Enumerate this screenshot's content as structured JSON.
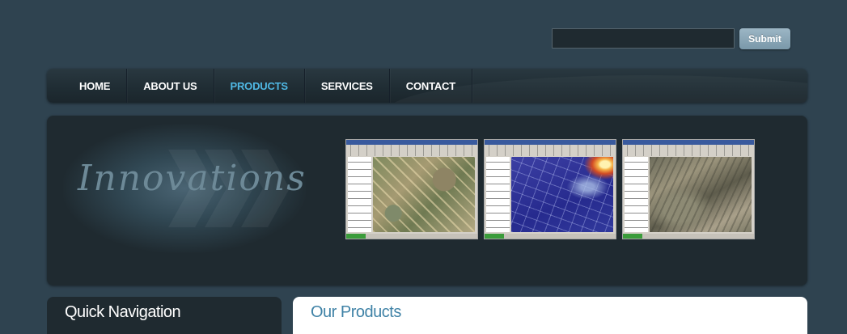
{
  "search": {
    "value": "",
    "placeholder": "",
    "submit_label": "Submit"
  },
  "nav": {
    "items": [
      {
        "label": "HOME",
        "active": false
      },
      {
        "label": "ABOUT US",
        "active": false
      },
      {
        "label": "PRODUCTS",
        "active": true
      },
      {
        "label": "SERVICES",
        "active": false
      },
      {
        "label": "CONTACT",
        "active": false
      }
    ]
  },
  "hero": {
    "title": "Innovations",
    "screenshots": [
      {
        "icon": "gis-aerial-map-thumbnail"
      },
      {
        "icon": "gis-plume-map-thumbnail"
      },
      {
        "icon": "gis-terrain-map-thumbnail"
      }
    ]
  },
  "sidebar": {
    "title": "Quick Navigation"
  },
  "main": {
    "title": "Our Products"
  },
  "colors": {
    "background": "#2f4350",
    "panel": "#1f2a30",
    "nav_active": "#4fb7e3",
    "heading_blue": "#3f82a6",
    "submit_button": "#8aa7b8"
  }
}
